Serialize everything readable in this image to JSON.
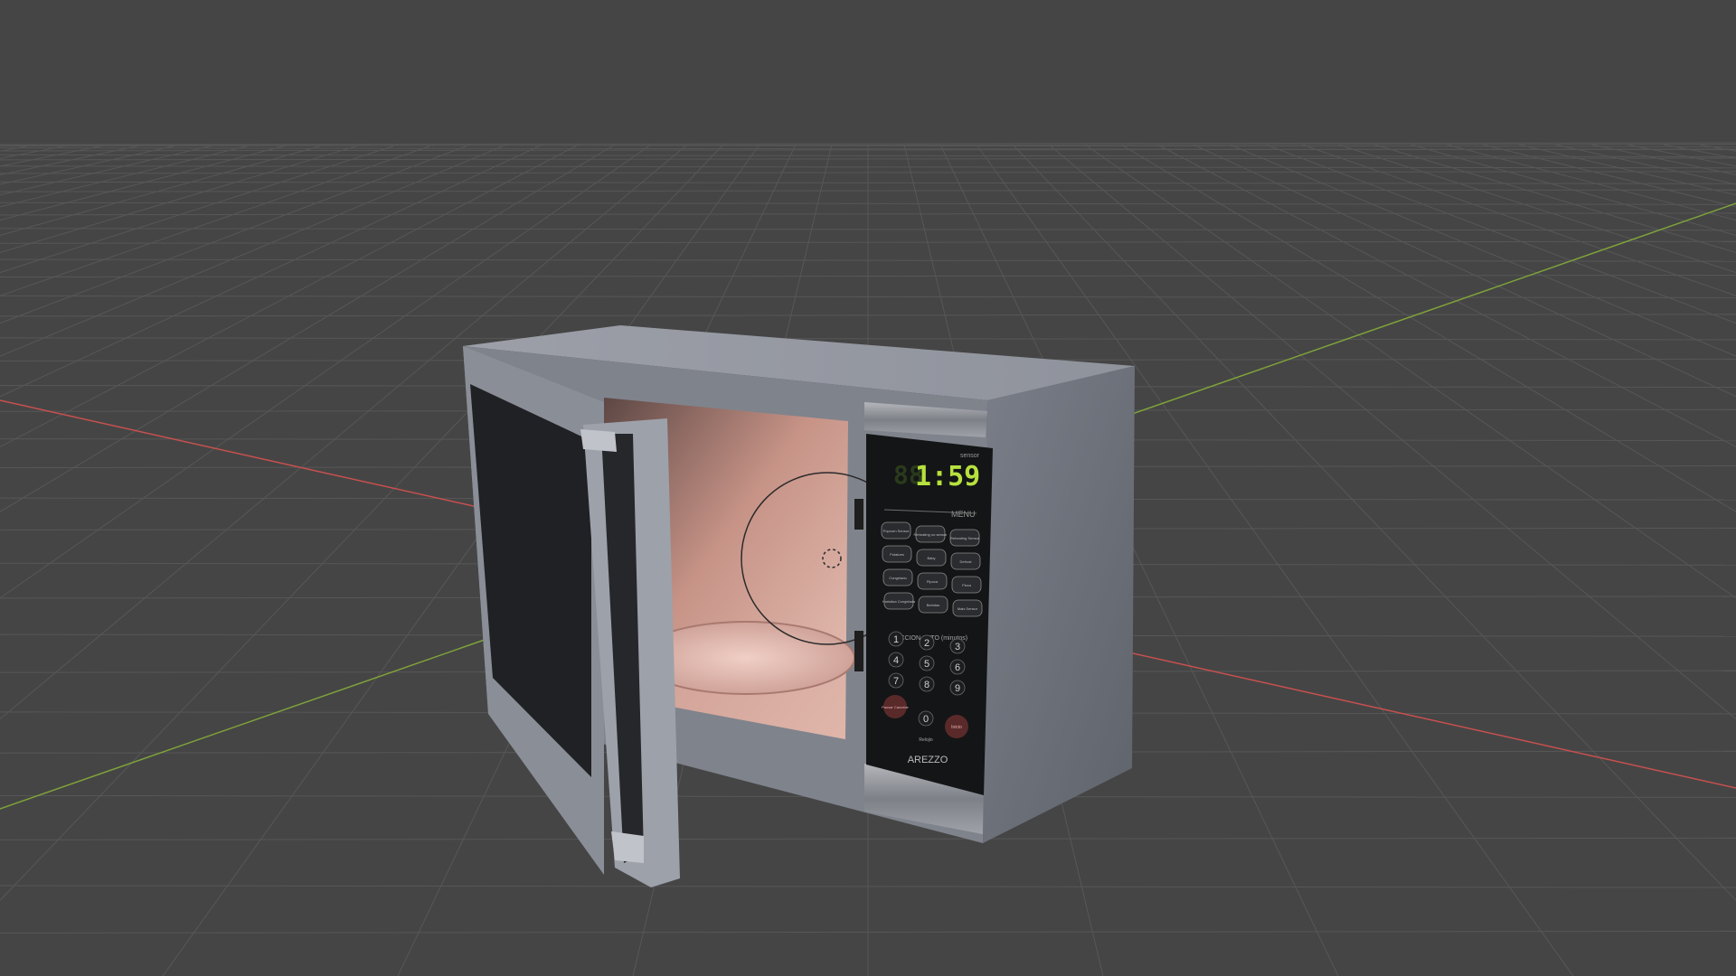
{
  "scene": {
    "background": "#454545",
    "grid_color": "#575757",
    "axis_x_color": "#c9504f",
    "axis_y_color": "#7fa23a"
  },
  "microwave": {
    "display_time": "1:59",
    "display_color": "#b7e13e",
    "top_right_label": "sensor",
    "menu_label": "MENU",
    "function_keys": [
      "Popcorn Sensor",
      "Reheating no sensor",
      "Reheating Sensor",
      "Potatoes",
      "Baby",
      "Defrost",
      "Congelado",
      "Pipoca",
      "Pizza",
      "Hortaliza Congelada",
      "Bebidas",
      "Mais Sensor"
    ],
    "pad_caption": "COCCION AUTO (minutos)",
    "number_keys": [
      "1",
      "2",
      "3",
      "4",
      "5",
      "6",
      "7",
      "8",
      "9",
      "0"
    ],
    "stop_key": "Pausar Cancelar",
    "start_key": "Inicio",
    "zero_caption": "Relojio",
    "brand": "AREZZO"
  }
}
